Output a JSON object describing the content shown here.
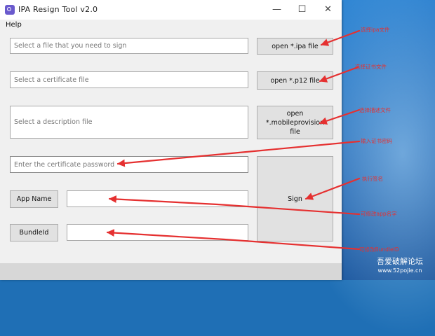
{
  "window": {
    "title": "IPA Resign Tool v2.0",
    "menu_help": "Help",
    "minimize_glyph": "—",
    "maximize_glyph": "☐",
    "close_glyph": "✕"
  },
  "form": {
    "ipa_placeholder": "Select a file that you need to sign",
    "cert_placeholder": "Select a certificate file",
    "desc_placeholder": "Select a description file",
    "password_placeholder": "Enter the certificate password",
    "app_name_value": "",
    "bundleid_value": ""
  },
  "buttons": {
    "open_ipa": "open *.ipa file",
    "open_p12": "open *.p12 file",
    "open_mobileprovision": "open\n*.mobileprovision\nfile",
    "sign": "Sign",
    "app_name": "App Name",
    "bundleid": "BundleId"
  },
  "annotations": {
    "note_ipa": "选择ipa文件",
    "note_p12": "选择证书文件",
    "note_mobileprovision": "选择描述文件",
    "note_password": "输入证书密码",
    "note_sign": "执行签名",
    "note_app_name": "可修改app名字",
    "note_bundleid": "可修改BundleID",
    "color": "#e53030"
  },
  "watermark": {
    "line1": "吾爱破解论坛",
    "line2": "www.52pojie.cn"
  },
  "colors": {
    "desktop": "#2b80cf",
    "window_bg": "#f0f0f0",
    "button_bg": "#e1e1e1",
    "app_icon": "#6a5acd"
  }
}
